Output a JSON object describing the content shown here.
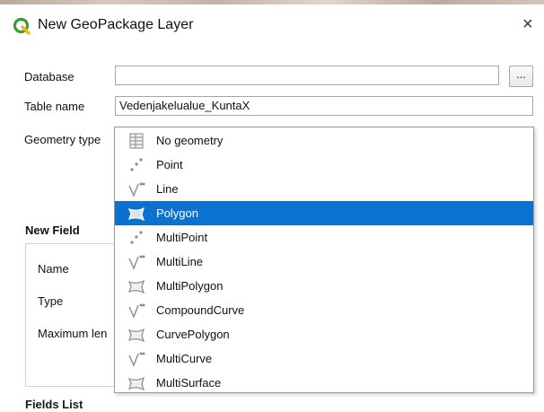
{
  "window": {
    "title": "New GeoPackage Layer",
    "close_symbol": "×",
    "accent": "#0b72cf"
  },
  "form": {
    "database_label": "Database",
    "database_value": "",
    "browse_label": "...",
    "table_name_label": "Table name",
    "table_name_value": "Vedenjakelualue_KuntaX",
    "geometry_type_label": "Geometry type"
  },
  "new_field": {
    "section_label": "New Field",
    "name_label": "Name",
    "type_label": "Type",
    "maximum_length_label": "Maximum len"
  },
  "fields_list": {
    "section_label": "Fields List"
  },
  "geometry_dropdown": {
    "selected": "Polygon",
    "items": [
      {
        "label": "No geometry",
        "icon": "table-icon"
      },
      {
        "label": "Point",
        "icon": "point-icon"
      },
      {
        "label": "Line",
        "icon": "line-icon"
      },
      {
        "label": "Polygon",
        "icon": "polygon-icon"
      },
      {
        "label": "MultiPoint",
        "icon": "point-icon"
      },
      {
        "label": "MultiLine",
        "icon": "line-icon"
      },
      {
        "label": "MultiPolygon",
        "icon": "polygon-icon"
      },
      {
        "label": "CompoundCurve",
        "icon": "line-icon"
      },
      {
        "label": "CurvePolygon",
        "icon": "polygon-icon"
      },
      {
        "label": "MultiCurve",
        "icon": "line-icon"
      },
      {
        "label": "MultiSurface",
        "icon": "polygon-icon"
      }
    ]
  }
}
